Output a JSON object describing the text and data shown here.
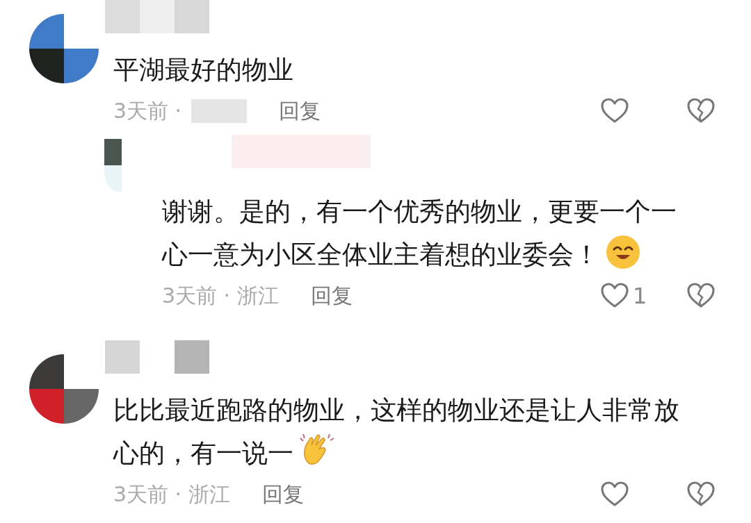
{
  "comments": [
    {
      "text": "平湖最好的物业",
      "meta": "3天前 ·",
      "location_redacted": true,
      "reply_label": "回复",
      "replies": [
        {
          "text": "谢谢。是的，有一个优秀的物业，更要一个一心一意为小区全体业主着想的业委会！",
          "trailing_icon": {
            "kind": "smile"
          },
          "meta": "3天前 · 浙江",
          "location_redacted": false,
          "reply_label": "回复",
          "likes": "1"
        }
      ]
    },
    {
      "text": "比比最近跑路的物业，这样的物业还是让人非常放心的，有一说一",
      "trailing_icon": {
        "kind": "clap"
      },
      "meta": "3天前 · 浙江",
      "location_redacted": false,
      "reply_label": "回复"
    }
  ]
}
